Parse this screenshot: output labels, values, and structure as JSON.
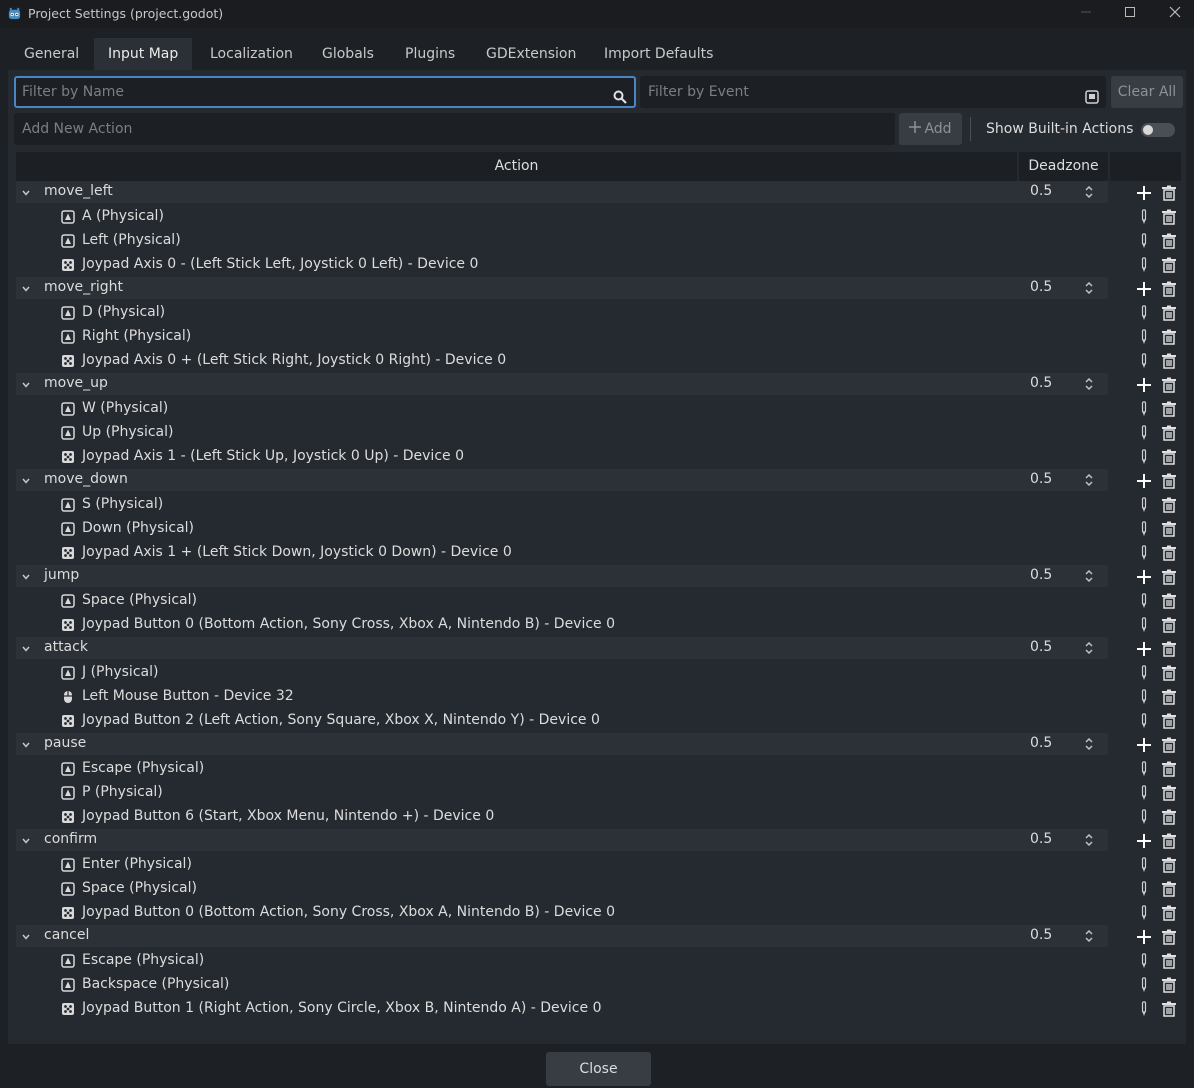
{
  "window": {
    "title": "Project Settings (project.godot)",
    "app_icon": "godot-icon",
    "controls": [
      "minimize-icon",
      "maximize-icon",
      "close-icon"
    ]
  },
  "tabs": [
    {
      "label": "General",
      "active": false
    },
    {
      "label": "Input Map",
      "active": true
    },
    {
      "label": "Localization",
      "active": false
    },
    {
      "label": "Globals",
      "active": false
    },
    {
      "label": "Plugins",
      "active": false
    },
    {
      "label": "GDExtension",
      "active": false
    },
    {
      "label": "Import Defaults",
      "active": false
    }
  ],
  "filters": {
    "name_placeholder": "Filter by Name",
    "event_placeholder": "Filter by Event",
    "clear_all": "Clear All"
  },
  "add_action": {
    "placeholder": "Add New Action",
    "add_label": "Add",
    "show_builtin_label": "Show Built-in Actions",
    "show_builtin_on": false
  },
  "columns": {
    "action": "Action",
    "deadzone": "Deadzone"
  },
  "actions": [
    {
      "name": "move_left",
      "deadzone": "0.5",
      "events": [
        {
          "type": "key",
          "label": "A (Physical)"
        },
        {
          "type": "key",
          "label": "Left (Physical)"
        },
        {
          "type": "joypad",
          "label": "Joypad Axis 0 - (Left Stick Left, Joystick 0 Left) - Device 0"
        }
      ]
    },
    {
      "name": "move_right",
      "deadzone": "0.5",
      "events": [
        {
          "type": "key",
          "label": "D (Physical)"
        },
        {
          "type": "key",
          "label": "Right (Physical)"
        },
        {
          "type": "joypad",
          "label": "Joypad Axis 0 + (Left Stick Right, Joystick 0 Right) - Device 0"
        }
      ]
    },
    {
      "name": "move_up",
      "deadzone": "0.5",
      "events": [
        {
          "type": "key",
          "label": "W (Physical)"
        },
        {
          "type": "key",
          "label": "Up (Physical)"
        },
        {
          "type": "joypad",
          "label": "Joypad Axis 1 - (Left Stick Up, Joystick 0 Up) - Device 0"
        }
      ]
    },
    {
      "name": "move_down",
      "deadzone": "0.5",
      "events": [
        {
          "type": "key",
          "label": "S (Physical)"
        },
        {
          "type": "key",
          "label": "Down (Physical)"
        },
        {
          "type": "joypad",
          "label": "Joypad Axis 1 + (Left Stick Down, Joystick 0 Down) - Device 0"
        }
      ]
    },
    {
      "name": "jump",
      "deadzone": "0.5",
      "events": [
        {
          "type": "key",
          "label": "Space (Physical)"
        },
        {
          "type": "joypad",
          "label": "Joypad Button 0 (Bottom Action, Sony Cross, Xbox A, Nintendo B) - Device 0"
        }
      ]
    },
    {
      "name": "attack",
      "deadzone": "0.5",
      "events": [
        {
          "type": "key",
          "label": "J (Physical)"
        },
        {
          "type": "mouse",
          "label": "Left Mouse Button - Device 32"
        },
        {
          "type": "joypad",
          "label": "Joypad Button 2 (Left Action, Sony Square, Xbox X, Nintendo Y) - Device 0"
        }
      ]
    },
    {
      "name": "pause",
      "deadzone": "0.5",
      "events": [
        {
          "type": "key",
          "label": "Escape (Physical)"
        },
        {
          "type": "key",
          "label": "P (Physical)"
        },
        {
          "type": "joypad",
          "label": "Joypad Button 6 (Start, Xbox Menu, Nintendo +) - Device 0"
        }
      ]
    },
    {
      "name": "confirm",
      "deadzone": "0.5",
      "events": [
        {
          "type": "key",
          "label": "Enter (Physical)"
        },
        {
          "type": "key",
          "label": "Space (Physical)"
        },
        {
          "type": "joypad",
          "label": "Joypad Button 0 (Bottom Action, Sony Cross, Xbox A, Nintendo B) - Device 0"
        }
      ]
    },
    {
      "name": "cancel",
      "deadzone": "0.5",
      "events": [
        {
          "type": "key",
          "label": "Escape (Physical)"
        },
        {
          "type": "key",
          "label": "Backspace (Physical)"
        },
        {
          "type": "joypad",
          "label": "Joypad Button 1 (Right Action, Sony Circle, Xbox B, Nintendo A) - Device 0"
        }
      ]
    }
  ],
  "footer": {
    "close_label": "Close"
  }
}
